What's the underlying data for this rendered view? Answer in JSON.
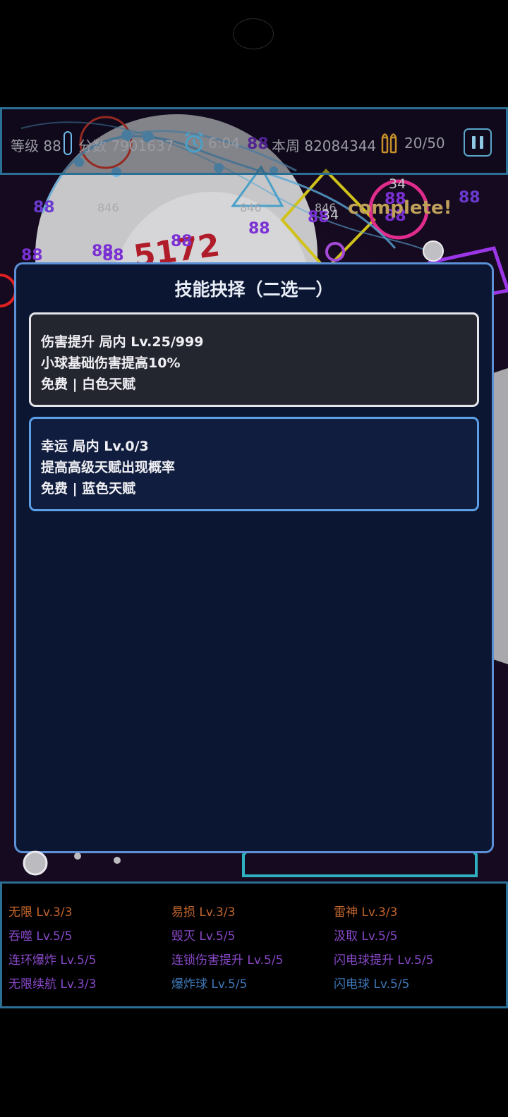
{
  "hud": {
    "level_label": "等级 88",
    "score_label": "分数 7901637",
    "timer": "6:04",
    "weekly_label": "本周 82084344",
    "ammo": "20/50"
  },
  "board": {
    "complete_text": "complete!",
    "big_number": "5172",
    "floating_numbers": [
      "88",
      "88",
      "88",
      "88",
      "88",
      "88",
      "88",
      "88",
      "88",
      "88",
      "88",
      "88"
    ],
    "brick_numbers": [
      "846",
      "846",
      "846",
      "846",
      "34",
      "34"
    ]
  },
  "dialog": {
    "title": "技能抉择（二选一）",
    "options": [
      {
        "line1": "伤害提升  局内 Lv.25/999",
        "line2": "小球基础伤害提高10%",
        "line3": "免费  |  白色天赋",
        "tier_color": "#e6e6ea"
      },
      {
        "line1": "幸运  局内 Lv.0/3",
        "line2": "提高高级天赋出现概率",
        "line3": "免费  |  蓝色天赋",
        "tier_color": "#5b9fe8"
      }
    ]
  },
  "talents": [
    {
      "label": "无限  Lv.3/3",
      "color": "orange"
    },
    {
      "label": "易损  Lv.3/3",
      "color": "orange"
    },
    {
      "label": "雷神  Lv.3/3",
      "color": "orange"
    },
    {
      "label": "吞噬  Lv.5/5",
      "color": "purple"
    },
    {
      "label": "毁灭  Lv.5/5",
      "color": "purple"
    },
    {
      "label": "汲取  Lv.5/5",
      "color": "purple"
    },
    {
      "label": "连环爆炸  Lv.5/5",
      "color": "purple"
    },
    {
      "label": "连锁伤害提升  Lv.5/5",
      "color": "purple"
    },
    {
      "label": "闪电球提升  Lv.5/5",
      "color": "purple"
    },
    {
      "label": "无限续航  Lv.3/3",
      "color": "purple"
    },
    {
      "label": "爆炸球  Lv.5/5",
      "color": "blue"
    },
    {
      "label": "闪电球  Lv.5/5",
      "color": "blue"
    }
  ],
  "colors": {
    "hud_border": "#2c6f95",
    "dialog_bg": "#0b1632",
    "dialog_border": "#5b8fd6",
    "talent_orange": "#c3652c",
    "talent_purple": "#8848c8",
    "talent_blue": "#3f78b8"
  }
}
